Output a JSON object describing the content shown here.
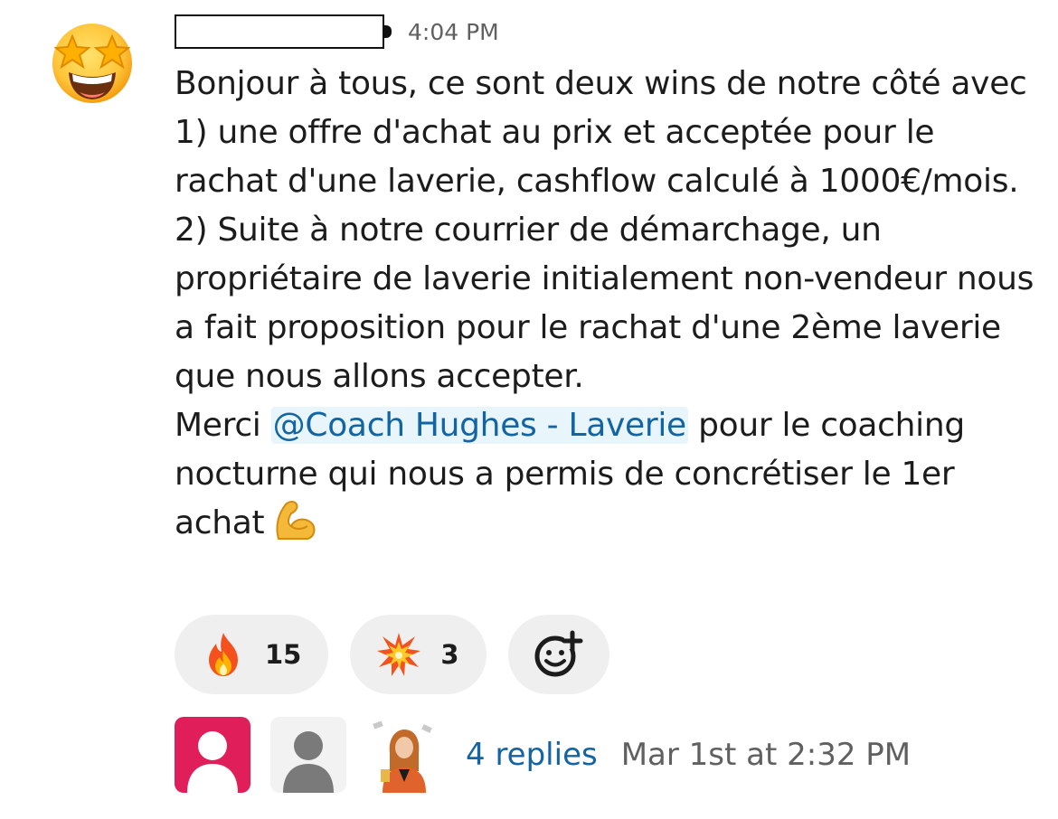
{
  "message": {
    "author_name": "",
    "time": "4:04 PM",
    "text_before_mention": "Bonjour à tous, ce sont deux wins de notre côté avec 1) une offre d'achat au prix et acceptée pour le rachat d'une laverie, cashflow calculé à 1000€/mois. 2) Suite à notre courrier de démarchage, un propriétaire de laverie initialement non-vendeur nous a fait proposition pour le rachat d'une 2ème laverie que nous allons accepter.",
    "merci": "Merci",
    "mention": "@Coach Hughes - Laverie",
    "text_after_mention": "pour le coaching nocturne qui nous a permis de concrétiser le 1er achat",
    "avatar_icon": "star-struck-emoji",
    "inline_emoji": "flexed-biceps-emoji"
  },
  "reactions": [
    {
      "icon": "fire-emoji",
      "count": "15"
    },
    {
      "icon": "collision-emoji",
      "count": "3"
    },
    {
      "icon": "add-reaction-icon"
    }
  ],
  "thread": {
    "replies_label": "4 replies",
    "last_reply": "Mar 1st at 2:32 PM",
    "reply_avatars": [
      "pink-default-avatar",
      "gray-default-avatar",
      "photo-avatar"
    ]
  },
  "colors": {
    "link": "#1264a3",
    "mention_bg": "#e8f5fa",
    "reaction_bg": "#efefef",
    "muted_text": "#616061",
    "pink_avatar": "#e01e5a"
  }
}
